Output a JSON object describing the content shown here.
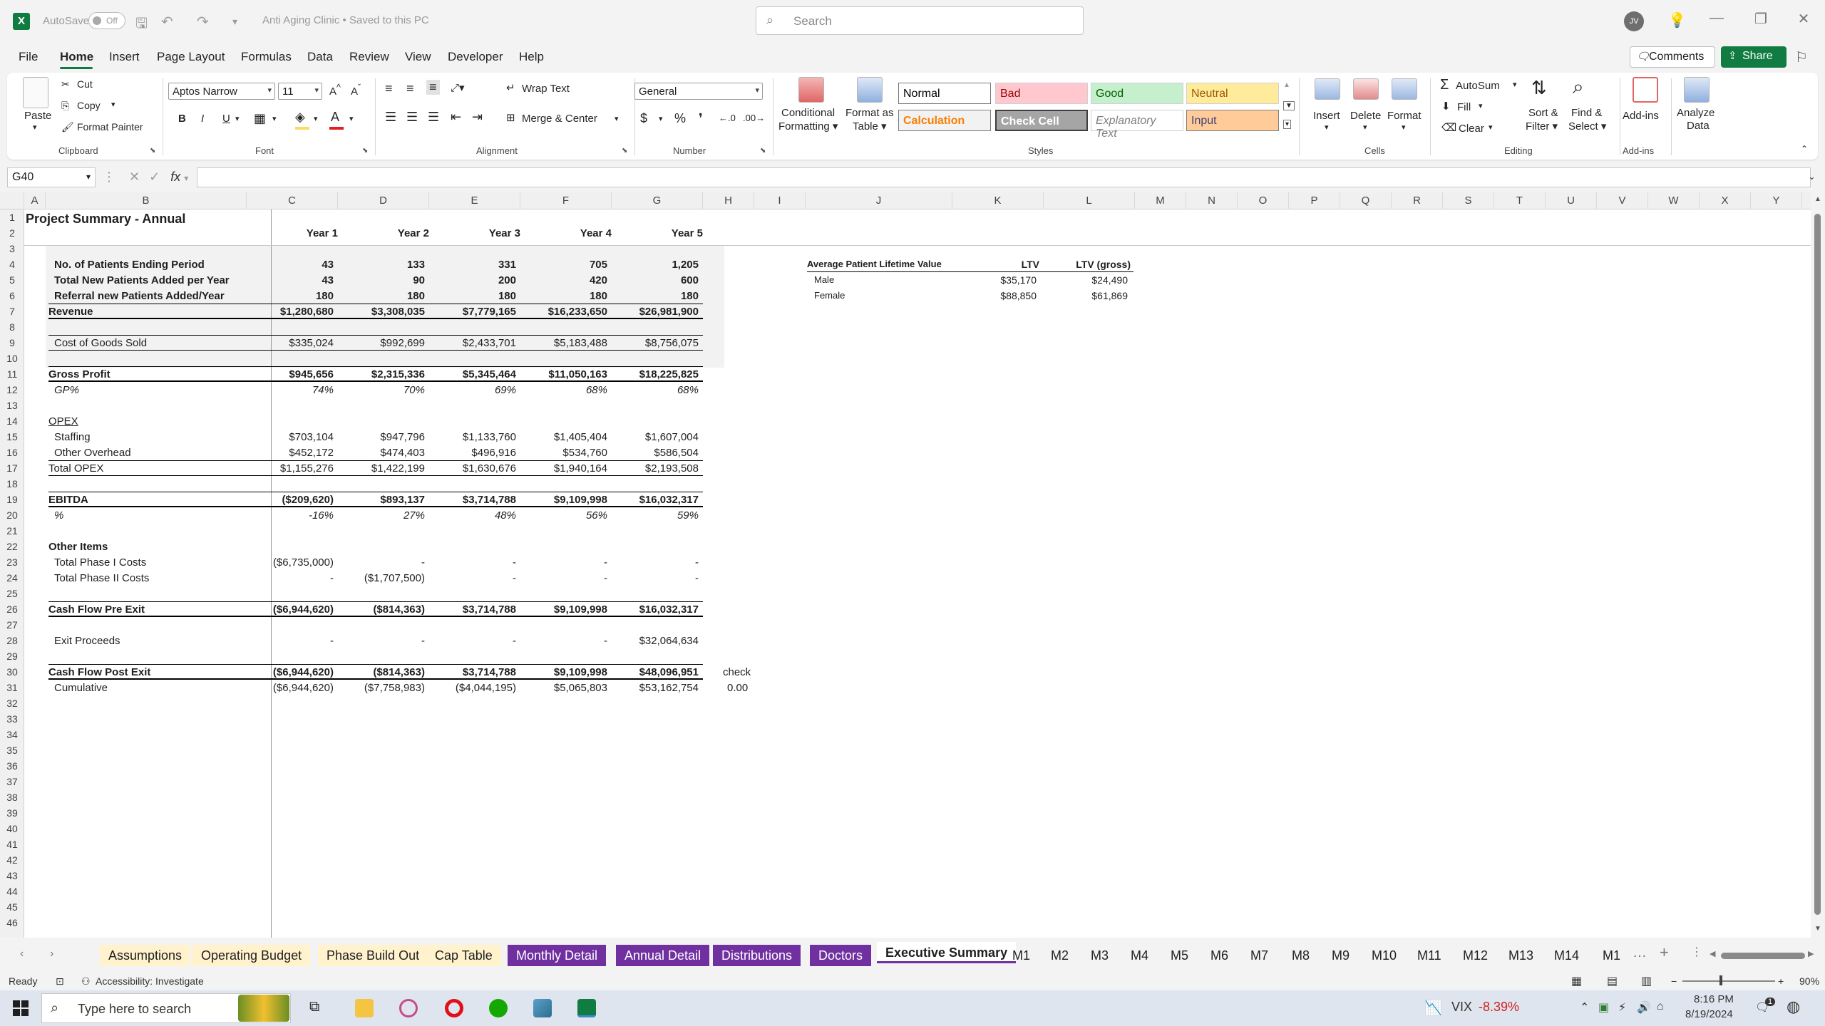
{
  "titlebar": {
    "app_icon": "X",
    "autosave_label": "AutoSave",
    "autosave_state": "Off",
    "doc_title": "Anti Aging Clinic • Saved to this PC",
    "search_placeholder": "Search",
    "user_initials": "JV",
    "window_buttons": [
      "—",
      "❐",
      "✕"
    ]
  },
  "menu": {
    "tabs": [
      "File",
      "Home",
      "Insert",
      "Page Layout",
      "Formulas",
      "Data",
      "Review",
      "View",
      "Developer",
      "Help"
    ],
    "comments_label": "Comments",
    "share_label": "Share"
  },
  "ribbon": {
    "clipboard": {
      "paste": "Paste",
      "cut": "Cut",
      "copy": "Copy",
      "format_painter": "Format Painter",
      "label": "Clipboard"
    },
    "font": {
      "name": "Aptos Narrow",
      "size": "11",
      "bold": "B",
      "italic": "I",
      "underline": "U",
      "label": "Font",
      "fill_color": "#ffd966",
      "font_color": "#e02020"
    },
    "alignment": {
      "wrap_text": "Wrap Text",
      "merge_center": "Merge & Center",
      "label": "Alignment"
    },
    "number": {
      "format": "General",
      "dollar": "$",
      "percent": "%",
      "comma": "❜",
      "label": "Number"
    },
    "styles": {
      "conditional": [
        "Conditional",
        "Formatting"
      ],
      "format_table": [
        "Format as",
        "Table"
      ],
      "cells": [
        {
          "name": "Normal",
          "bg": "#ffffff",
          "fg": "#000000"
        },
        {
          "name": "Bad",
          "bg": "#ffc7ce",
          "fg": "#9c0006"
        },
        {
          "name": "Good",
          "bg": "#c6efce",
          "fg": "#006100"
        },
        {
          "name": "Neutral",
          "bg": "#ffeb9c",
          "fg": "#9c5700"
        },
        {
          "name": "Calculation",
          "bg": "#f2f2f2",
          "fg": "#fa7d00"
        },
        {
          "name": "Check Cell",
          "bg": "#a5a5a5",
          "fg": "#ffffff"
        },
        {
          "name": "Explanatory Text",
          "bg": "#ffffff",
          "fg": "#7f7f7f"
        },
        {
          "name": "Input",
          "bg": "#ffcc99",
          "fg": "#3f3f76"
        }
      ],
      "label": "Styles"
    },
    "cells": {
      "insert": "Insert",
      "delete": "Delete",
      "format": "Format",
      "label": "Cells"
    },
    "editing": {
      "autosum": "AutoSum",
      "fill": "Fill",
      "clear": "Clear",
      "sort_filter": [
        "Sort &",
        "Filter"
      ],
      "find_select": [
        "Find &",
        "Select"
      ],
      "label": "Editing"
    },
    "addins": {
      "addins": "Add-ins",
      "analyze": [
        "Analyze",
        "Data"
      ],
      "label": "Add-ins"
    }
  },
  "formula_bar": {
    "name_box": "G40",
    "fx": "fx",
    "value": ""
  },
  "columns": [
    "A",
    "B",
    "C",
    "D",
    "E",
    "F",
    "G",
    "H",
    "I",
    "J",
    "K",
    "L",
    "M",
    "N",
    "O",
    "P",
    "Q",
    "R",
    "S",
    "T",
    "U",
    "V",
    "W",
    "X",
    "Y"
  ],
  "rows": [
    "1",
    "2",
    "3",
    "4",
    "5",
    "6",
    "7",
    "8",
    "9",
    "10",
    "11",
    "12",
    "13",
    "14",
    "15",
    "16",
    "17",
    "18",
    "19",
    "20",
    "21",
    "22",
    "23",
    "24",
    "25",
    "26",
    "27",
    "28",
    "29",
    "30",
    "31",
    "32",
    "33",
    "34",
    "35",
    "36",
    "37",
    "38",
    "39",
    "40",
    "41",
    "42",
    "43",
    "44",
    "45",
    "46"
  ],
  "sheet": {
    "title": "Project Summary - Annual",
    "years": [
      "Year 1",
      "Year 2",
      "Year 3",
      "Year 4",
      "Year 5"
    ],
    "patients_ending": {
      "label": "No. of Patients Ending Period",
      "values": [
        "43",
        "133",
        "331",
        "705",
        "1,205"
      ]
    },
    "new_patients": {
      "label": "Total New Patients Added per Year",
      "values": [
        "43",
        "90",
        "200",
        "420",
        "600"
      ]
    },
    "referral": {
      "label": "Referral new Patients Added/Year",
      "values": [
        "180",
        "180",
        "180",
        "180",
        "180"
      ]
    },
    "revenue": {
      "label": "Revenue",
      "values": [
        "$1,280,680",
        "$3,308,035",
        "$7,779,165",
        "$16,233,650",
        "$26,981,900"
      ]
    },
    "cogs": {
      "label": "Cost of Goods Sold",
      "values": [
        "$335,024",
        "$992,699",
        "$2,433,701",
        "$5,183,488",
        "$8,756,075"
      ]
    },
    "gross_profit": {
      "label": "Gross Profit",
      "values": [
        "$945,656",
        "$2,315,336",
        "$5,345,464",
        "$11,050,163",
        "$18,225,825"
      ]
    },
    "gp_pct": {
      "label": "GP%",
      "values": [
        "74%",
        "70%",
        "69%",
        "68%",
        "68%"
      ]
    },
    "opex_label": "OPEX",
    "staffing": {
      "label": "Staffing",
      "values": [
        "$703,104",
        "$947,796",
        "$1,133,760",
        "$1,405,404",
        "$1,607,004"
      ]
    },
    "other_overhead": {
      "label": "Other Overhead",
      "values": [
        "$452,172",
        "$474,403",
        "$496,916",
        "$534,760",
        "$586,504"
      ]
    },
    "total_opex": {
      "label": "Total OPEX",
      "values": [
        "$1,155,276",
        "$1,422,199",
        "$1,630,676",
        "$1,940,164",
        "$2,193,508"
      ]
    },
    "ebitda": {
      "label": "EBITDA",
      "values": [
        "($209,620)",
        "$893,137",
        "$3,714,788",
        "$9,109,998",
        "$16,032,317"
      ]
    },
    "ebitda_pct": {
      "label": "%",
      "values": [
        "-16%",
        "27%",
        "48%",
        "56%",
        "59%"
      ]
    },
    "other_items_label": "Other Items",
    "phase1": {
      "label": "Total Phase I Costs",
      "values": [
        "($6,735,000)",
        "-",
        "-",
        "-",
        "-"
      ]
    },
    "phase2": {
      "label": "Total Phase II Costs",
      "values": [
        "-",
        "($1,707,500)",
        "-",
        "-",
        "-"
      ]
    },
    "cf_pre": {
      "label": "Cash Flow Pre Exit",
      "values": [
        "($6,944,620)",
        "($814,363)",
        "$3,714,788",
        "$9,109,998",
        "$16,032,317"
      ]
    },
    "exit_proceeds": {
      "label": "Exit Proceeds",
      "values": [
        "-",
        "-",
        "-",
        "-",
        "$32,064,634"
      ]
    },
    "cf_post": {
      "label": "Cash Flow Post Exit",
      "values": [
        "($6,944,620)",
        "($814,363)",
        "$3,714,788",
        "$9,109,998",
        "$48,096,951"
      ]
    },
    "cumulative": {
      "label": "Cumulative",
      "values": [
        "($6,944,620)",
        "($7,758,983)",
        "($4,044,195)",
        "$5,065,803",
        "$53,162,754"
      ]
    },
    "check_label": "check",
    "check_value": "0.00",
    "ltv": {
      "header": "Average Patient Lifetime Value",
      "col1": "LTV",
      "col2": "LTV (gross)",
      "rows": [
        {
          "label": "Male",
          "ltv": "$35,170",
          "gross": "$24,490"
        },
        {
          "label": "Female",
          "ltv": "$88,850",
          "gross": "$61,869"
        }
      ]
    }
  },
  "sheet_tabs": [
    {
      "name": "Assumptions",
      "style": "yellow"
    },
    {
      "name": "Operating Budget",
      "style": "yellow"
    },
    {
      "name": "Phase Build Out",
      "style": "yellow"
    },
    {
      "name": "Cap Table",
      "style": "yellow"
    },
    {
      "name": "Monthly Detail",
      "style": "purple"
    },
    {
      "name": "Annual Detail",
      "style": "purple"
    },
    {
      "name": "Distributions",
      "style": "purple"
    },
    {
      "name": "Doctors",
      "style": "purple"
    },
    {
      "name": "Executive Summary",
      "style": "active"
    },
    {
      "name": "M1",
      "style": "plain"
    },
    {
      "name": "M2",
      "style": "plain"
    },
    {
      "name": "M3",
      "style": "plain"
    },
    {
      "name": "M4",
      "style": "plain"
    },
    {
      "name": "M5",
      "style": "plain"
    },
    {
      "name": "M6",
      "style": "plain"
    },
    {
      "name": "M7",
      "style": "plain"
    },
    {
      "name": "M8",
      "style": "plain"
    },
    {
      "name": "M9",
      "style": "plain"
    },
    {
      "name": "M10",
      "style": "plain"
    },
    {
      "name": "M11",
      "style": "plain"
    },
    {
      "name": "M12",
      "style": "plain"
    },
    {
      "name": "M13",
      "style": "plain"
    },
    {
      "name": "M14",
      "style": "plain"
    },
    {
      "name": "M1",
      "style": "plain"
    }
  ],
  "sheet_tab_more": "…",
  "sheet_tab_add": "+",
  "status": {
    "ready": "Ready",
    "accessibility": "Accessibility: Investigate",
    "zoom": "90%"
  },
  "taskbar": {
    "search_placeholder": "Type here to search",
    "vix_label": "VIX",
    "vix_change": "-8.39%",
    "time": "8:16 PM",
    "date": "8/19/2024",
    "notification_count": "1"
  }
}
